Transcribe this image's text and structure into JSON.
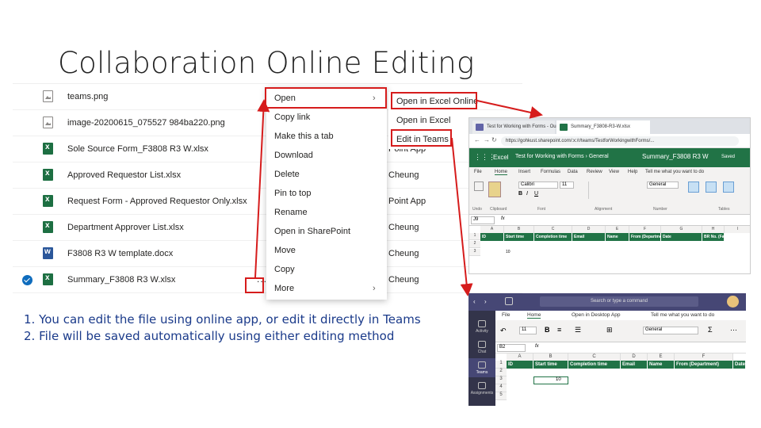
{
  "slide": {
    "title": "Collaboration Online Editing"
  },
  "files": [
    {
      "name": "teams.png",
      "icon": "image-file-icon",
      "right": "",
      "checked": false
    },
    {
      "name": "image-20200615_075527 984ba220.png",
      "icon": "image-file-icon",
      "right": "",
      "checked": false
    },
    {
      "name": "Sole Source Form_F3808 R3 W.xlsx",
      "icon": "excel-file-icon",
      "right": "Point App",
      "checked": false
    },
    {
      "name": "Approved Requestor List.xlsx",
      "icon": "excel-file-icon",
      "right": "Cheung",
      "checked": false
    },
    {
      "name": "Request Form - Approved Requestor Only.xlsx",
      "icon": "excel-file-icon",
      "right": "Point App",
      "checked": false
    },
    {
      "name": "Department Approver List.xlsx",
      "icon": "excel-file-icon",
      "right": "Cheung",
      "checked": false
    },
    {
      "name": "F3808 R3 W template.docx",
      "icon": "word-file-icon",
      "right": "Cheung",
      "checked": false
    },
    {
      "name": "Summary_F3808 R3 W.xlsx",
      "icon": "excel-file-icon",
      "right": "Cheung",
      "checked": true
    }
  ],
  "more_label": "...",
  "context_menu": [
    {
      "label": "Open",
      "submenu": true
    },
    {
      "label": "Copy link",
      "submenu": false
    },
    {
      "label": "Make this a tab",
      "submenu": false
    },
    {
      "label": "Download",
      "submenu": false
    },
    {
      "label": "Delete",
      "submenu": false
    },
    {
      "label": "Pin to top",
      "submenu": false
    },
    {
      "label": "Rename",
      "submenu": false
    },
    {
      "label": "Open in SharePoint",
      "submenu": false
    },
    {
      "label": "Move",
      "submenu": false
    },
    {
      "label": "Copy",
      "submenu": false
    },
    {
      "label": "More",
      "submenu": true
    }
  ],
  "open_submenu": [
    "Open in Excel Online",
    "Open in Excel",
    "Edit in Teams"
  ],
  "excel_online": {
    "tabs": [
      "Test for Working with Forms - Ou",
      "Summary_F3808-R3-W.xlsx"
    ],
    "url": "https://gohkust.sharepoint.com/:x:/r/teams/TestforWorkingwithForms/...",
    "app_name": "Excel",
    "breadcrumb": "Test for Working with Forms › General",
    "doc_title": "Summary_F3808 R3 W",
    "saved": "Saved",
    "menu": [
      "File",
      "Home",
      "Insert",
      "Formulas",
      "Data",
      "Review",
      "View",
      "Help",
      "Tell me what you want to do"
    ],
    "font": "Calibri",
    "font_size": "11",
    "number_format": "General",
    "ribbon_groups": [
      "Undo",
      "Clipboard",
      "Font",
      "Alignment",
      "Number",
      "Tables"
    ],
    "name_box": "J9",
    "columns": [
      "A",
      "B",
      "C",
      "D",
      "E",
      "F",
      "G",
      "H",
      "I"
    ],
    "headers": [
      "ID",
      "Start time",
      "Completion time",
      "Email",
      "Name",
      "From (Department)",
      "Date",
      "BR No. (Fam"
    ],
    "rows": [
      "1",
      "2",
      "3"
    ],
    "cell_value": "10"
  },
  "teams_excel": {
    "search": "Search or type a command",
    "nav": [
      "Activity",
      "Chat",
      "Teams",
      "Assignments"
    ],
    "menu": [
      "File",
      "Home",
      "Open in Desktop App",
      "Tell me what you want to do"
    ],
    "font_size": "11",
    "number_format": "General",
    "name_box": "B2",
    "columns": [
      "A",
      "B",
      "C",
      "D",
      "E",
      "F"
    ],
    "headers": [
      "ID",
      "Start time",
      "Completion time",
      "Email",
      "Name",
      "From (Department)",
      "Date"
    ],
    "rows": [
      "1",
      "2",
      "3",
      "4",
      "5"
    ],
    "cell_value": "10"
  },
  "notes": [
    "1.  You can edit the file using online app, or edit it directly in Teams",
    "2.  File will be saved automatically using either editing method"
  ],
  "colors": {
    "excel_green": "#217346",
    "teams_purple": "#464775",
    "highlight_red": "#d61c1c",
    "notes_blue": "#1a3a8a"
  }
}
